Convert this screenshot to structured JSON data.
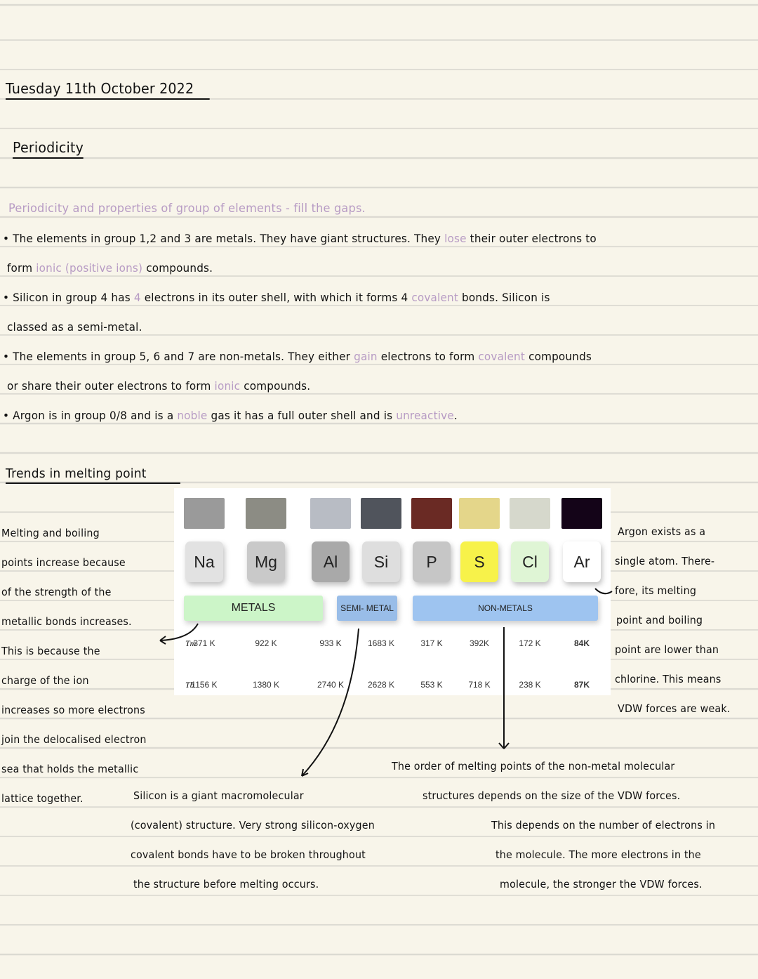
{
  "date": "Tuesday 11th October 2022",
  "title": "Periodicity",
  "subtitle": "Periodicity and properties of group of elements - fill the gaps.",
  "bullets": [
    [
      {
        "t": "• The elements in group 1,2 and 3 are metals. They have giant structures. They "
      },
      {
        "t": "lose",
        "fill": true
      },
      {
        "t": " their outer electrons to"
      }
    ],
    [
      {
        "t": "form "
      },
      {
        "t": "ionic (positive ions)",
        "fill": true
      },
      {
        "t": " compounds."
      }
    ],
    [
      {
        "t": "• Silicon in group 4 has "
      },
      {
        "t": "4",
        "fill": true
      },
      {
        "t": " electrons in its outer shell, with which it forms 4 "
      },
      {
        "t": "covalent",
        "fill": true
      },
      {
        "t": " bonds. Silicon is"
      }
    ],
    [
      {
        "t": "  classed as a semi-metal."
      }
    ],
    [
      {
        "t": "• The elements in group 5, 6 and 7 are non-metals. They either "
      },
      {
        "t": "gain",
        "fill": true
      },
      {
        "t": " electrons to form "
      },
      {
        "t": "covalent",
        "fill": true
      },
      {
        "t": " compounds"
      }
    ],
    [
      {
        "t": "or share their outer electrons to form "
      },
      {
        "t": "ionic",
        "fill": true
      },
      {
        "t": " compounds."
      }
    ],
    [
      {
        "t": "• Argon is in group 0/8 and is a "
      },
      {
        "t": "noble",
        "fill": true
      },
      {
        "t": " gas it has a full outer shell and is "
      },
      {
        "t": "unreactive",
        "fill": true
      },
      {
        "t": "."
      }
    ]
  ],
  "section2": "Trends in melting point",
  "left_notes": [
    "Melting and boiling",
    "points increase because",
    "of the strength of the",
    "metallic bonds increases.",
    "This is because the",
    "charge of the ion",
    "increases so more electrons",
    "join the delocalised electron",
    "sea that holds the metallic",
    "lattice together."
  ],
  "right_notes": [
    "Argon exists as a",
    "single atom. There-",
    "fore, its melting",
    "point and boiling",
    "point are lower than",
    "chlorine. This means",
    "VDW forces are weak."
  ],
  "silicon_notes": [
    "Silicon is a giant macromolecular",
    "(covalent) structure. Very strong silicon-oxygen",
    "covalent bonds have to be broken throughout",
    "the structure before melting occurs."
  ],
  "nonmetal_notes": [
    "The order of melting points of the non-metal molecular",
    "structures depends on the size of the VDW forces.",
    "This depends on the number of electrons in",
    "the molecule. The more electrons in the",
    "molecule, the stronger the VDW forces."
  ],
  "table": {
    "elements": [
      {
        "symbol": "Na",
        "color": "#e2e2e2",
        "img": "#9a9a9a",
        "tm": "371 K",
        "tb": "1156 K"
      },
      {
        "symbol": "Mg",
        "color": "#c9c9c9",
        "img": "#8c8c84",
        "tm": "922 K",
        "tb": "1380 K"
      },
      {
        "symbol": "Al",
        "color": "#a9a9a9",
        "img": "#b8bcc4",
        "tm": "933 K",
        "tb": "2740 K"
      },
      {
        "symbol": "Si",
        "color": "#dedede",
        "img": "#50545c",
        "tm": "1683 K",
        "tb": "2628 K"
      },
      {
        "symbol": "P",
        "color": "#c6c6c6",
        "img": "#6a2a24",
        "tm": "317 K",
        "tb": "553 K"
      },
      {
        "symbol": "S",
        "color": "#f7f24a",
        "img": "#e4d68a",
        "tm": "392K",
        "tb": "718 K"
      },
      {
        "symbol": "Cl",
        "color": "#dff5d5",
        "img": "#d6d8cc",
        "tm": "172 K",
        "tb": "238 K"
      },
      {
        "symbol": "Ar",
        "color": "#ffffff",
        "img": "#140418",
        "tm": "84K",
        "tb": "87K"
      }
    ],
    "bands": {
      "metals": "METALS",
      "semi": "SEMI- METAL",
      "non": "NON-METALS"
    },
    "tm_label": "Tm",
    "tb_label": "Tb",
    "colors": {
      "metals": "#ccf5c8",
      "semi": "#99bde8",
      "non": "#9ec4f0"
    }
  },
  "colors": {
    "fill_words": "#b79bc4",
    "ink": "#111111",
    "paper": "#f8f5ea"
  }
}
